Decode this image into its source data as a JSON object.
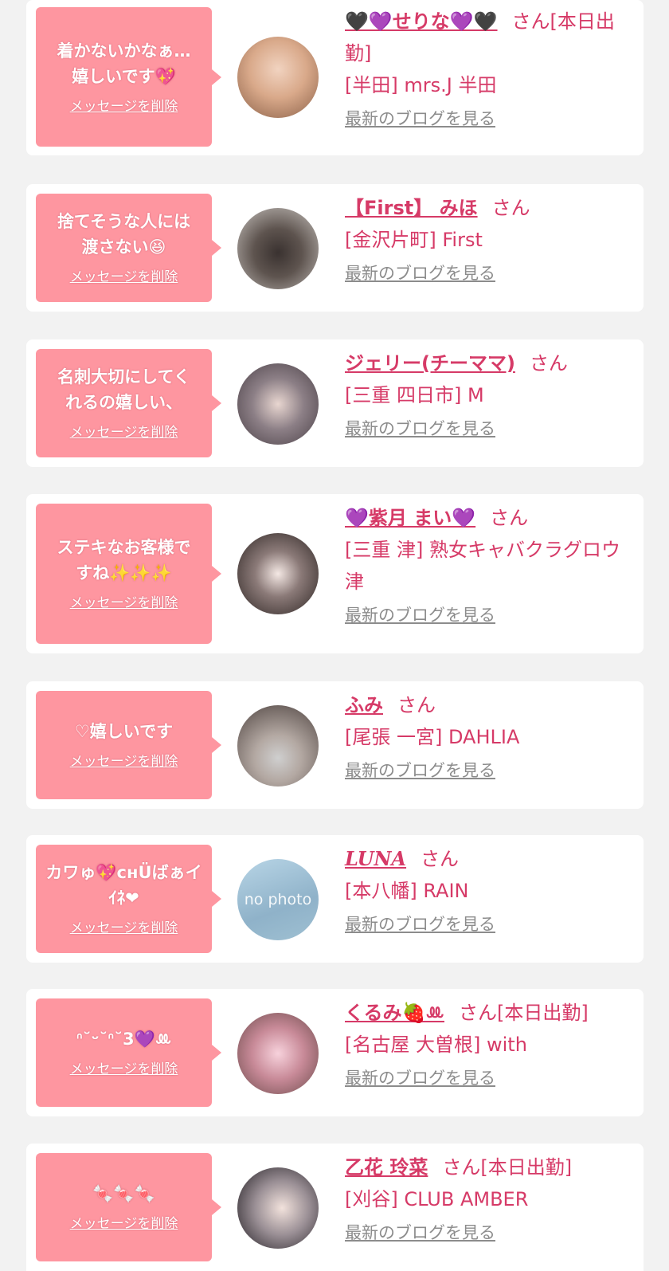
{
  "items": [
    {
      "message": "着かないかなぁ…\n嬉しいです💖",
      "delete_label": "メッセージを削除",
      "name": "🖤💜せりな💜🖤",
      "suffix": "さん[本日出勤]",
      "shop": "[半田] mrs.J 半田",
      "blog_label": "最新のブログを見る"
    },
    {
      "message": "捨てそうな人には\n渡さない😆",
      "delete_label": "メッセージを削除",
      "name": "【First】 みほ",
      "suffix": "さん",
      "shop": "[金沢片町] First",
      "blog_label": "最新のブログを見る"
    },
    {
      "message": "名刺大切にしてく\nれるの嬉しい、",
      "delete_label": "メッセージを削除",
      "name": "ジェリー(チーママ)",
      "suffix": "さん",
      "shop": "[三重 四日市] M",
      "blog_label": "最新のブログを見る"
    },
    {
      "message": "ステキなお客様で\nすね✨✨✨",
      "delete_label": "メッセージを削除",
      "name": "💜紫月 まい💜",
      "suffix": "さん",
      "shop": "[三重 津] 熟女キャバクラグロウ津",
      "blog_label": "最新のブログを見る"
    },
    {
      "message": "♡嬉しいです",
      "delete_label": "メッセージを削除",
      "name": "ふみ",
      "suffix": "さん",
      "shop": "[尾張 一宮] DAHLIA",
      "blog_label": "最新のブログを見る"
    },
    {
      "message": "カワゅ💖cнÜばぁイ\nｲﾈ❤",
      "delete_label": "メッセージを削除",
      "name": "LUNA",
      "suffix": "さん",
      "shop": "[本八幡] RAIN",
      "blog_label": "最新のブログを見る",
      "avatar_text": "no photo"
    },
    {
      "message": "ᐢ˘ᵕ˘ᐢ˘3💜ꔛ",
      "delete_label": "メッセージを削除",
      "name": "くるみ🍓ꔛ",
      "suffix": "さん[本日出勤]",
      "shop": "[名古屋 大曽根] with",
      "blog_label": "最新のブログを見る"
    },
    {
      "message": "🍬🍬🍬",
      "delete_label": "メッセージを削除",
      "name": "乙花 玲菜",
      "suffix": "さん[本日出勤]",
      "shop": "[刈谷] CLUB AMBER",
      "blog_label": "最新のブログを見る"
    }
  ]
}
